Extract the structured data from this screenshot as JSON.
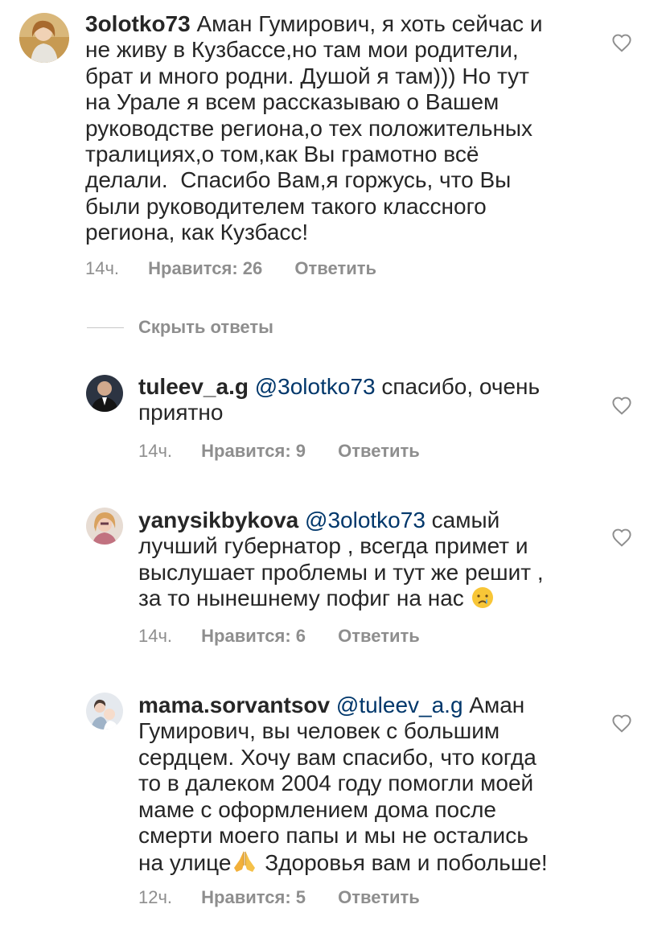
{
  "comments": [
    {
      "username": "3olotko73",
      "body": " Аман Гумирович, я хоть сейчас и\nне живу в Кузбассе,но там мои родители,\nбрат и много родни. Душой я там))) Но тут\nна Урале я всем рассказываю о Вашем\nруководстве региона,о тех положительных\nтралициях,о том,как Вы грамотно всё\nделали.  Спасибо Вам,я горжусь, что Вы\nбыли руководителем такого классного\nрегиона, как Кузбасс!",
      "time": "14ч.",
      "likes": "Нравится: 26",
      "reply": "Ответить"
    }
  ],
  "hide_replies": "Скрыть ответы",
  "replies": [
    {
      "username": "tuleev_a.g",
      "mention": "@3olotko73",
      "body": " спасибо, очень\nприятно",
      "time": "14ч.",
      "likes": "Нравится: 9",
      "reply": "Ответить"
    },
    {
      "username": "yanysikbykova",
      "mention": "@3olotko73",
      "body": " самый\nлучший губернатор , всегда примет и\nвыслушает проблемы и тут же решит ,\nза то нынешнему пофиг на нас ",
      "emoji": "crying-face",
      "time": "14ч.",
      "likes": "Нравится: 6",
      "reply": "Ответить"
    },
    {
      "username": "mama.sorvantsov",
      "mention": "@tuleev_a.g",
      "body": " Аман\nГумирович, вы человек с большим\nсердцем. Хочу вам спасибо, что когда\nто в далеком 2004 году помогли моей\nмаме с оформлением дома после\nсмерти моего папы и мы не остались\nна улице",
      "emoji": "folded-hands",
      "body_after_emoji": " Здоровья вам и побольше!",
      "time": "12ч.",
      "likes": "Нравится: 5",
      "reply": "Ответить"
    }
  ],
  "colors": {
    "text": "#262626",
    "secondary": "#8e8e8e",
    "mention": "#00376b"
  }
}
